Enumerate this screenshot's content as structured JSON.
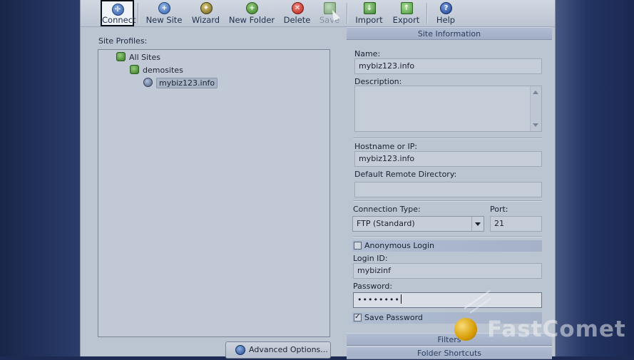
{
  "toolbar": {
    "buttons": [
      {
        "label": "Connect",
        "icon": "connect-icon",
        "state": "active"
      },
      {
        "label": "New Site",
        "icon": "new-site-icon"
      },
      {
        "label": "Wizard",
        "icon": "wizard-icon"
      },
      {
        "label": "New Folder",
        "icon": "new-folder-icon"
      },
      {
        "label": "Delete",
        "icon": "delete-icon"
      },
      {
        "label": "Save",
        "icon": "save-icon",
        "state": "disabled"
      },
      {
        "label": "Import",
        "icon": "import-icon"
      },
      {
        "label": "Export",
        "icon": "export-icon"
      },
      {
        "label": "Help",
        "icon": "help-icon"
      }
    ]
  },
  "site_profiles": {
    "label": "Site Profiles:",
    "tree": [
      {
        "label": "All Sites",
        "level": 0,
        "icon": "all-sites-icon"
      },
      {
        "label": "demosites",
        "level": 1,
        "icon": "folder-icon"
      },
      {
        "label": "mybiz123.info",
        "level": 2,
        "icon": "site-icon",
        "selected": true
      }
    ],
    "advanced_button": "Advanced Options..."
  },
  "site_info": {
    "header": "Site Information",
    "name_label": "Name:",
    "name_value": "mybiz123.info",
    "description_label": "Description:",
    "description_value": "",
    "hostname_label": "Hostname or IP:",
    "hostname_value": "mybiz123.info",
    "remote_dir_label": "Default Remote Directory:",
    "remote_dir_value": "",
    "connection_type_label": "Connection Type:",
    "connection_type_value": "FTP (Standard)",
    "port_label": "Port:",
    "port_value": "21",
    "anonymous_label": "Anonymous Login",
    "anonymous_checked": false,
    "login_label": "Login ID:",
    "login_value": "mybizinf",
    "password_label": "Password:",
    "password_value": "••••••••",
    "save_password_label": "Save Password",
    "save_password_checked": true
  },
  "sections": {
    "filters": "Filters",
    "folder_shortcuts": "Folder Shortcuts"
  },
  "watermark": {
    "text": "FastComet"
  },
  "colors": {
    "accent": "#2f5aa8",
    "background": "#1d2b52",
    "panel": "#c2cad6"
  }
}
